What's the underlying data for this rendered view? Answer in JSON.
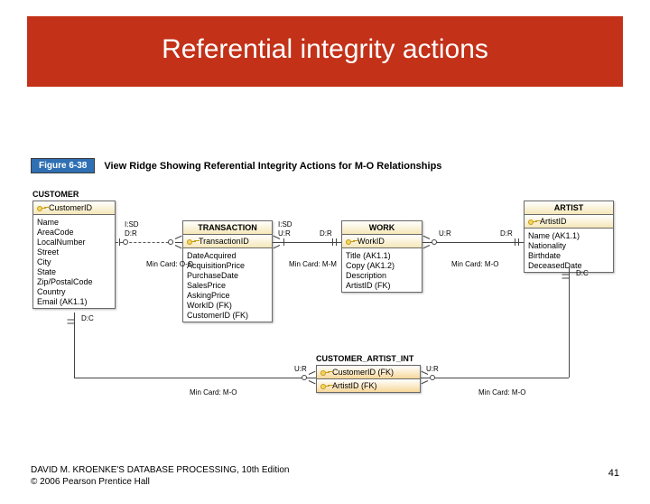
{
  "title": "Referential integrity actions",
  "figure": {
    "badge": "Figure 6-38",
    "caption": "View Ridge Showing Referential Integrity Actions for M-O Relationships"
  },
  "entities": {
    "customer": {
      "title": "CUSTOMER",
      "pk": "CustomerID",
      "fields": [
        "Name",
        "AreaCode",
        "LocalNumber",
        "Street",
        "City",
        "State",
        "Zip/PostalCode",
        "Country",
        "Email (AK1.1)"
      ]
    },
    "transaction": {
      "title": "TRANSACTION",
      "pk": "TransactionID",
      "fields": [
        "DateAcquired",
        "AcquisitionPrice",
        "PurchaseDate",
        "SalesPrice",
        "AskingPrice",
        "WorkID (FK)",
        "CustomerID (FK)"
      ]
    },
    "work": {
      "title": "WORK",
      "pk": "WorkID",
      "fields": [
        "Title (AK1.1)",
        "Copy (AK1.2)",
        "Description",
        "ArtistID (FK)"
      ]
    },
    "artist": {
      "title": "ARTIST",
      "pk": "ArtistID",
      "fields": [
        "Name (AK1.1)",
        "Nationality",
        "Birthdate",
        "DeceasedDate"
      ]
    },
    "cai": {
      "title": "CUSTOMER_ARTIST_INT",
      "pk1": "CustomerID (FK)",
      "pk2": "ArtistID (FK)"
    }
  },
  "labels": {
    "ct_left_top": "I:SD",
    "ct_left_bot": "D:R",
    "ct_right_top": "I:SD",
    "ct_right_bot": "U:R",
    "tw_right": "D:R",
    "wa_left": "U:R",
    "wa_right": "D:R",
    "cust_dc": "D:C",
    "artist_dc": "D:C",
    "cai_left": "U:R",
    "cai_right": "U:R",
    "min_oo": "Min Card: O-O",
    "min_mm": "Min Card: M-M",
    "min_mo1": "Min Card: M-O",
    "min_mo2": "Min Card: M-O",
    "min_mo3": "Min Card: M-O"
  },
  "footer": {
    "line1": "DAVID M. KROENKE'S DATABASE PROCESSING, 10th Edition",
    "line2": "© 2006 Pearson Prentice Hall"
  },
  "page": "41"
}
